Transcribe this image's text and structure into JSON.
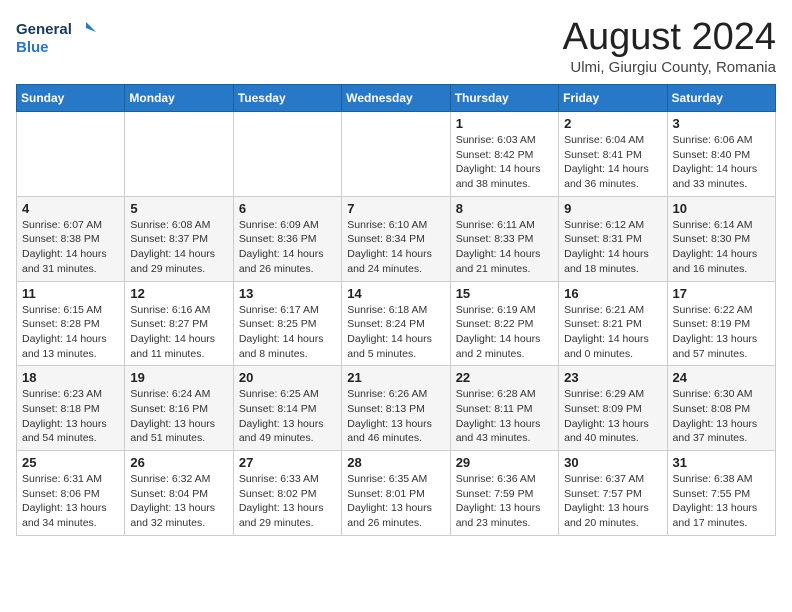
{
  "header": {
    "logo_line1": "General",
    "logo_line2": "Blue",
    "month_title": "August 2024",
    "location": "Ulmi, Giurgiu County, Romania"
  },
  "weekdays": [
    "Sunday",
    "Monday",
    "Tuesday",
    "Wednesday",
    "Thursday",
    "Friday",
    "Saturday"
  ],
  "weeks": [
    [
      {
        "day": "",
        "info": ""
      },
      {
        "day": "",
        "info": ""
      },
      {
        "day": "",
        "info": ""
      },
      {
        "day": "",
        "info": ""
      },
      {
        "day": "1",
        "info": "Sunrise: 6:03 AM\nSunset: 8:42 PM\nDaylight: 14 hours and 38 minutes."
      },
      {
        "day": "2",
        "info": "Sunrise: 6:04 AM\nSunset: 8:41 PM\nDaylight: 14 hours and 36 minutes."
      },
      {
        "day": "3",
        "info": "Sunrise: 6:06 AM\nSunset: 8:40 PM\nDaylight: 14 hours and 33 minutes."
      }
    ],
    [
      {
        "day": "4",
        "info": "Sunrise: 6:07 AM\nSunset: 8:38 PM\nDaylight: 14 hours and 31 minutes."
      },
      {
        "day": "5",
        "info": "Sunrise: 6:08 AM\nSunset: 8:37 PM\nDaylight: 14 hours and 29 minutes."
      },
      {
        "day": "6",
        "info": "Sunrise: 6:09 AM\nSunset: 8:36 PM\nDaylight: 14 hours and 26 minutes."
      },
      {
        "day": "7",
        "info": "Sunrise: 6:10 AM\nSunset: 8:34 PM\nDaylight: 14 hours and 24 minutes."
      },
      {
        "day": "8",
        "info": "Sunrise: 6:11 AM\nSunset: 8:33 PM\nDaylight: 14 hours and 21 minutes."
      },
      {
        "day": "9",
        "info": "Sunrise: 6:12 AM\nSunset: 8:31 PM\nDaylight: 14 hours and 18 minutes."
      },
      {
        "day": "10",
        "info": "Sunrise: 6:14 AM\nSunset: 8:30 PM\nDaylight: 14 hours and 16 minutes."
      }
    ],
    [
      {
        "day": "11",
        "info": "Sunrise: 6:15 AM\nSunset: 8:28 PM\nDaylight: 14 hours and 13 minutes."
      },
      {
        "day": "12",
        "info": "Sunrise: 6:16 AM\nSunset: 8:27 PM\nDaylight: 14 hours and 11 minutes."
      },
      {
        "day": "13",
        "info": "Sunrise: 6:17 AM\nSunset: 8:25 PM\nDaylight: 14 hours and 8 minutes."
      },
      {
        "day": "14",
        "info": "Sunrise: 6:18 AM\nSunset: 8:24 PM\nDaylight: 14 hours and 5 minutes."
      },
      {
        "day": "15",
        "info": "Sunrise: 6:19 AM\nSunset: 8:22 PM\nDaylight: 14 hours and 2 minutes."
      },
      {
        "day": "16",
        "info": "Sunrise: 6:21 AM\nSunset: 8:21 PM\nDaylight: 14 hours and 0 minutes."
      },
      {
        "day": "17",
        "info": "Sunrise: 6:22 AM\nSunset: 8:19 PM\nDaylight: 13 hours and 57 minutes."
      }
    ],
    [
      {
        "day": "18",
        "info": "Sunrise: 6:23 AM\nSunset: 8:18 PM\nDaylight: 13 hours and 54 minutes."
      },
      {
        "day": "19",
        "info": "Sunrise: 6:24 AM\nSunset: 8:16 PM\nDaylight: 13 hours and 51 minutes."
      },
      {
        "day": "20",
        "info": "Sunrise: 6:25 AM\nSunset: 8:14 PM\nDaylight: 13 hours and 49 minutes."
      },
      {
        "day": "21",
        "info": "Sunrise: 6:26 AM\nSunset: 8:13 PM\nDaylight: 13 hours and 46 minutes."
      },
      {
        "day": "22",
        "info": "Sunrise: 6:28 AM\nSunset: 8:11 PM\nDaylight: 13 hours and 43 minutes."
      },
      {
        "day": "23",
        "info": "Sunrise: 6:29 AM\nSunset: 8:09 PM\nDaylight: 13 hours and 40 minutes."
      },
      {
        "day": "24",
        "info": "Sunrise: 6:30 AM\nSunset: 8:08 PM\nDaylight: 13 hours and 37 minutes."
      }
    ],
    [
      {
        "day": "25",
        "info": "Sunrise: 6:31 AM\nSunset: 8:06 PM\nDaylight: 13 hours and 34 minutes."
      },
      {
        "day": "26",
        "info": "Sunrise: 6:32 AM\nSunset: 8:04 PM\nDaylight: 13 hours and 32 minutes."
      },
      {
        "day": "27",
        "info": "Sunrise: 6:33 AM\nSunset: 8:02 PM\nDaylight: 13 hours and 29 minutes."
      },
      {
        "day": "28",
        "info": "Sunrise: 6:35 AM\nSunset: 8:01 PM\nDaylight: 13 hours and 26 minutes."
      },
      {
        "day": "29",
        "info": "Sunrise: 6:36 AM\nSunset: 7:59 PM\nDaylight: 13 hours and 23 minutes."
      },
      {
        "day": "30",
        "info": "Sunrise: 6:37 AM\nSunset: 7:57 PM\nDaylight: 13 hours and 20 minutes."
      },
      {
        "day": "31",
        "info": "Sunrise: 6:38 AM\nSunset: 7:55 PM\nDaylight: 13 hours and 17 minutes."
      }
    ]
  ]
}
